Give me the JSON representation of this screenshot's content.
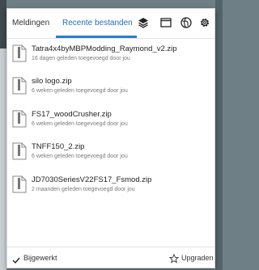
{
  "tabs": {
    "notifications": "Meldingen",
    "recent": "Recente bestanden"
  },
  "toolbar_icons": [
    "layers-icon",
    "window-icon",
    "globe-icon",
    "gear-icon"
  ],
  "files": [
    {
      "name": "Tatra4x4byMBPModding_Raymond_v2.zip",
      "meta": "16 dagen geleden toegevoegd door jou"
    },
    {
      "name": "silo logo.zip",
      "meta": "6 weken geleden toegevoegd door jou"
    },
    {
      "name": "FS17_woodCrusher.zip",
      "meta": "6 weken geleden toegevoegd door jou"
    },
    {
      "name": "TNFF150_2.zip",
      "meta": "6 weken geleden toegevoegd door jou"
    },
    {
      "name": "JD7030SeriesV22FS17_Fsmod.zip",
      "meta": "2 maanden geleden toegevoegd door jou"
    }
  ],
  "footer": {
    "status": "Bijgewerkt",
    "upgrade": "Upgraden"
  },
  "colors": {
    "accent": "#2b7cd3",
    "active_tab_text": "#1f6fb5"
  }
}
